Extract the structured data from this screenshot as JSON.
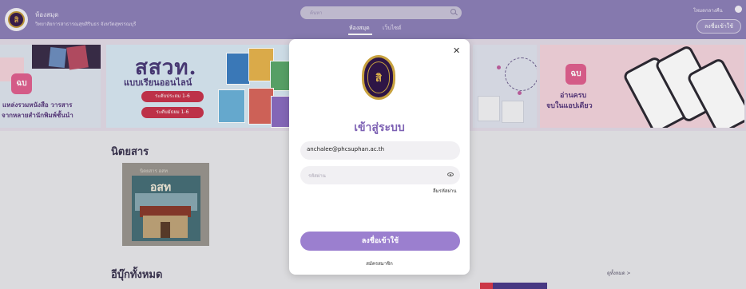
{
  "header": {
    "library_name": "ห้องสมุด",
    "school_name": "วิทยาลัยการสาธารณสุขสิรินธร จังหวัดสุพรรณบุรี",
    "search_placeholder": "ค้นหา",
    "nav_home": "ห้องสมุด",
    "nav_website": "เว็บไซต์",
    "language": "โหมดกลางคืน",
    "login_label": "ลงชื่อเข้าใช้",
    "logo_letter": "สิ"
  },
  "banners": {
    "b1_badge": "ฉบ",
    "b1_line1": "แหล่งรวมหนังสือ วารสาร",
    "b1_line2": "จากหลายสำนักพิมพ์ชั้นนำ",
    "b2_title": "สสวท.",
    "b2_subtitle": "แบบเรียนออนไลน์",
    "b2_pill1": "ระดับประถม 1-6",
    "b2_pill2": "ระดับมัธยม 1-6",
    "b4_badge": "ฉบ",
    "b4_line1": "อ่านครบ",
    "b4_line2": "จบในแอปเดียว"
  },
  "content": {
    "magazines_title": "นิตยสาร",
    "magazine_card_label": "นิตยสาร อสท",
    "magazine_cover_title": "อสท",
    "all_ebooks_title": "อีบุ๊กทั้งหมด",
    "see_all": "ดูทั้งหมด >"
  },
  "modal": {
    "seal_letter": "สิ",
    "title": "เข้าสู่ระบบ",
    "email_value": "anchalee@phcsuphan.ac.th",
    "password_placeholder": "รหัสผ่าน",
    "forgot_password": "ลืมรหัสผ่าน",
    "submit_label": "ลงชื่อเข้าใช้",
    "register_label": "สมัครสมาชิก"
  },
  "colors": {
    "topbar": "#8d80b8",
    "accent": "#9b7fcf",
    "title": "#7e62b4"
  }
}
